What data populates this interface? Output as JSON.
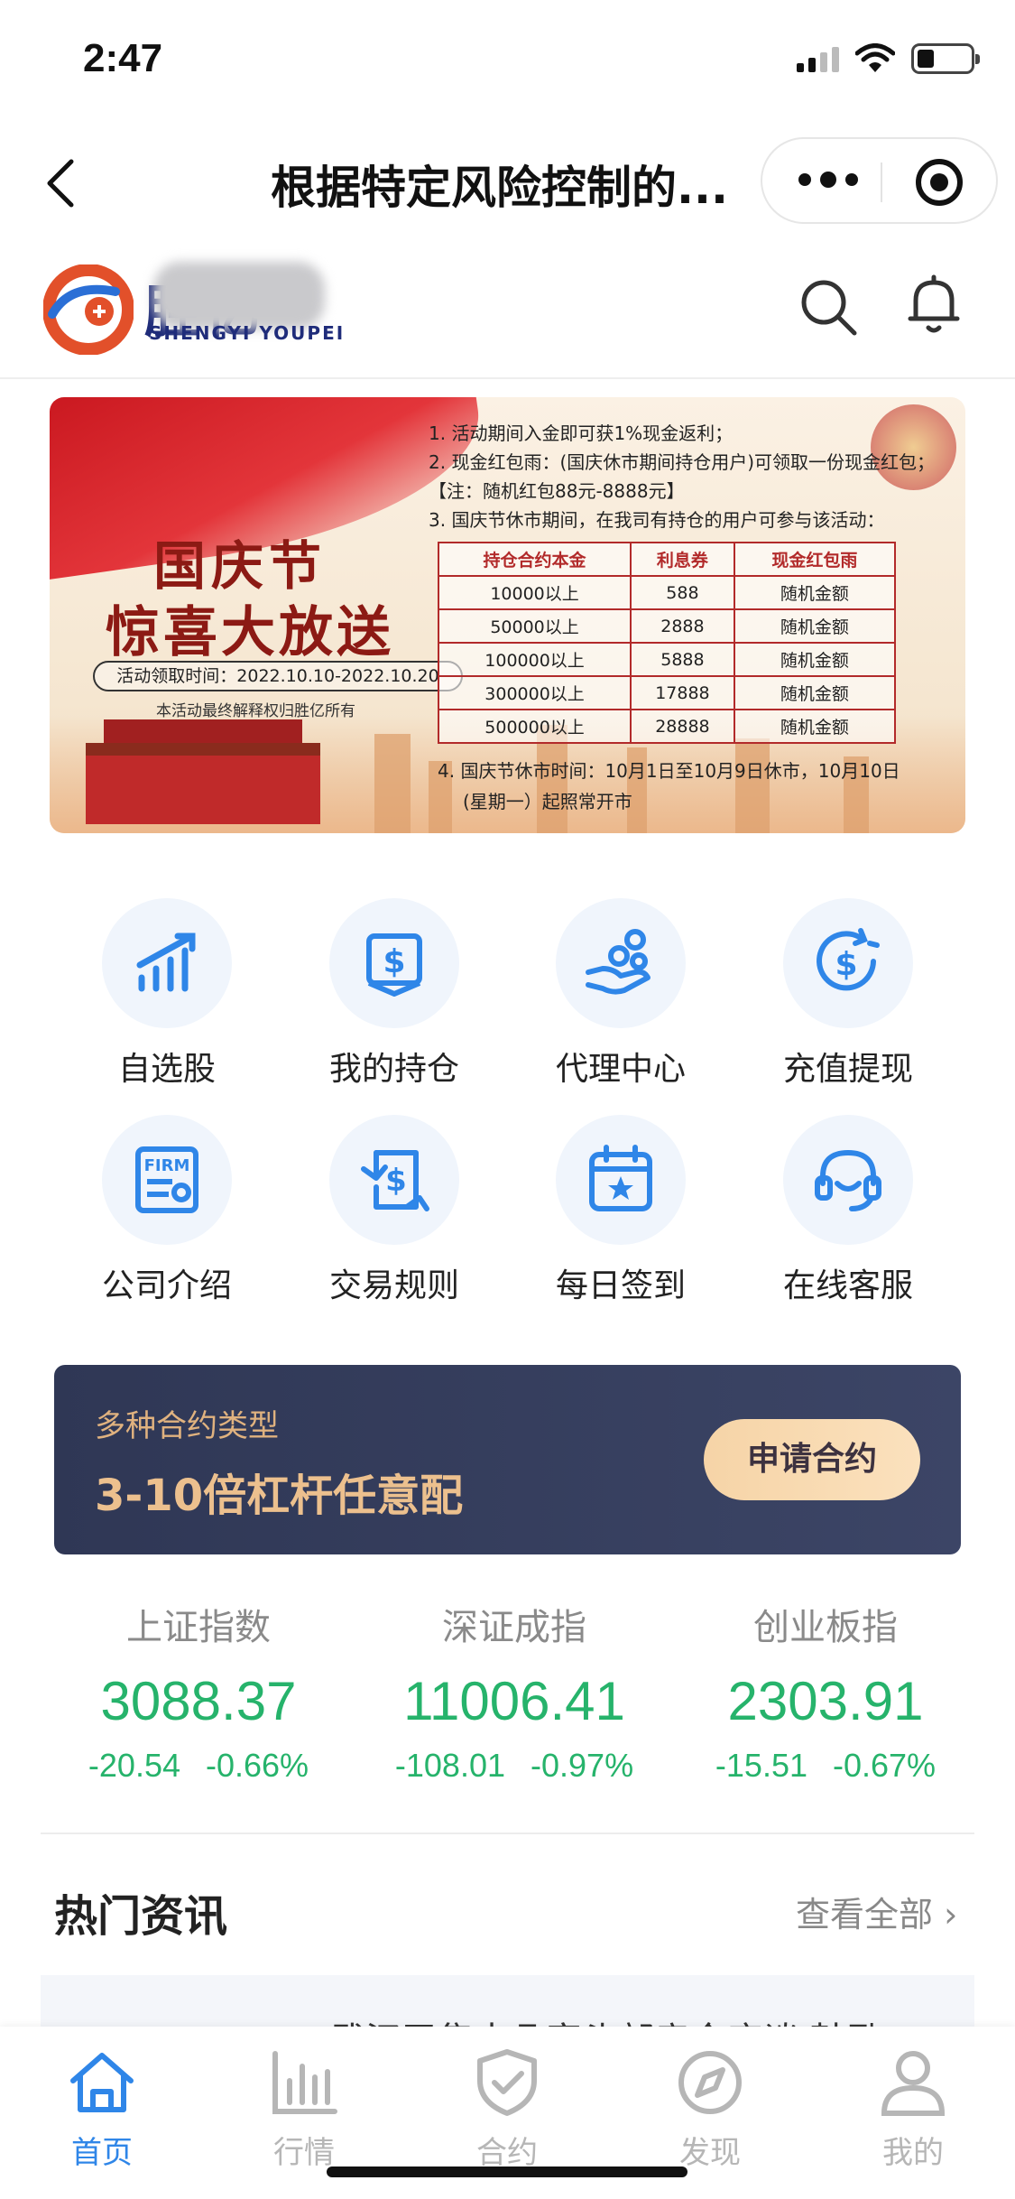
{
  "status_bar": {
    "time": "2:47"
  },
  "nav": {
    "title": "根据特定风险控制的..."
  },
  "brand": {
    "name": "胜亿",
    "subtitle": "SHENGYI YOUPEI"
  },
  "banner": {
    "festival_line1": "国庆节",
    "festival_line2": "惊喜大放送",
    "period": "活动领取时间：2022.10.10-2022.10.20",
    "note": "本活动最终解释权归胜亿所有",
    "rule1": "1. 活动期间入金即可获1%现金返利；",
    "rule2": "2. 现金红包雨：(国庆休市期间持仓用户)可领取一份现金红包；",
    "rule2_note": "【注：随机红包88元-8888元】",
    "rule3": "3. 国庆节休市期间，在我司有持仓的用户可参与该活动：",
    "table_headers": [
      "持仓合约本金",
      "利息券",
      "现金红包雨"
    ],
    "table_rows": [
      [
        "10000以上",
        "588",
        "随机金额"
      ],
      [
        "50000以上",
        "2888",
        "随机金额"
      ],
      [
        "100000以上",
        "5888",
        "随机金额"
      ],
      [
        "300000以上",
        "17888",
        "随机金额"
      ],
      [
        "500000以上",
        "28888",
        "随机金额"
      ]
    ],
    "rule4_line1": "4. 国庆节休市时间：10月1日至10月9日休市，10月10日",
    "rule4_line2": "(星期一）起照常开市"
  },
  "grid": [
    {
      "label": "自选股",
      "icon": "chart-bars-icon"
    },
    {
      "label": "我的持仓",
      "icon": "wallet-icon"
    },
    {
      "label": "代理中心",
      "icon": "hand-coins-icon"
    },
    {
      "label": "充值提现",
      "icon": "coin-exchange-icon"
    },
    {
      "label": "公司介绍",
      "icon": "firm-card-icon"
    },
    {
      "label": "交易规则",
      "icon": "dollar-doc-icon"
    },
    {
      "label": "每日签到",
      "icon": "calendar-star-icon"
    },
    {
      "label": "在线客服",
      "icon": "headset-icon"
    }
  ],
  "promo": {
    "subtitle": "多种合约类型",
    "title": "3-10倍杠杆任意配",
    "button": "申请合约"
  },
  "indices": [
    {
      "name": "上证指数",
      "value": "3088.37",
      "change": "-20.54",
      "percent": "-0.66%"
    },
    {
      "name": "深证成指",
      "value": "11006.41",
      "change": "-108.01",
      "percent": "-0.97%"
    },
    {
      "name": "创业板指",
      "value": "2303.91",
      "change": "-15.51",
      "percent": "-0.67%"
    }
  ],
  "news": {
    "title": "热门资讯",
    "more": "查看全部",
    "first_headline": "武汉召集十几家头部房企座谈 鼓励"
  },
  "tabs": [
    {
      "label": "首页",
      "icon": "home-icon",
      "active": true
    },
    {
      "label": "行情",
      "icon": "market-bars-icon",
      "active": false
    },
    {
      "label": "合约",
      "icon": "shield-check-icon",
      "active": false
    },
    {
      "label": "发现",
      "icon": "compass-icon",
      "active": false
    },
    {
      "label": "我的",
      "icon": "user-icon",
      "active": false
    }
  ],
  "colors": {
    "accent": "#2f86e8",
    "down_green": "#26b36b",
    "promo_bg": "#2f3755",
    "promo_gold": "#ecc08e"
  }
}
